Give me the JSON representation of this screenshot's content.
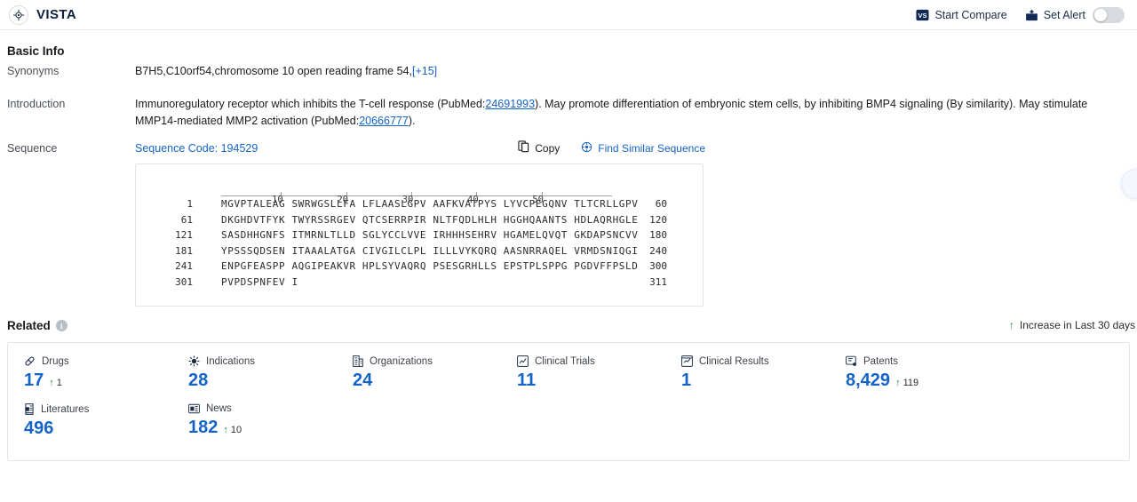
{
  "header": {
    "brand_icon": "target-crosshair-icon",
    "title": "VISTA",
    "start_compare": "Start Compare",
    "start_compare_icon": "vs-compare-icon",
    "set_alert": "Set Alert",
    "set_alert_icon": "alert-bell-icon",
    "alert_toggle_state": "off"
  },
  "basic_info": {
    "title": "Basic Info",
    "synonyms_label": "Synonyms",
    "synonyms_value": "B7H5,C10orf54,chromosome 10 open reading frame 54,",
    "synonyms_more": "[+15]",
    "introduction_label": "Introduction",
    "intro_part1": "Immunoregulatory receptor which inhibits the T-cell response (PubMed:",
    "intro_pmid1": "24691993",
    "intro_part2": "). May promote differentiation of embryonic stem cells, by inhibiting BMP4 signaling (By similarity). May stimulate MMP14-mediated MMP2 activation (PubMed:",
    "intro_pmid2": "20666777",
    "intro_part3": ")."
  },
  "sequence": {
    "label": "Sequence",
    "code_label": "Sequence Code: 194529",
    "copy_label": "Copy",
    "copy_icon": "copy-icon",
    "find_similar_label": "Find Similar Sequence",
    "find_similar_icon": "find-similar-icon",
    "ruler_ticks": [
      10,
      20,
      30,
      40,
      50
    ],
    "lines": [
      {
        "start": "1",
        "letters": "MGVPTALEAG SWRWGSLLFA LFLAASLGPV AAFKVATPYS LYVCPEGQNV TLTCRLLGPV",
        "end": "60"
      },
      {
        "start": "61",
        "letters": "DKGHDVTFYK TWYRSSRGEV QTCSERRPIR NLTFQDLHLH HGGHQAANTS HDLAQRHGLE",
        "end": "120"
      },
      {
        "start": "121",
        "letters": "SASDHHGNFS ITMRNLTLLD SGLYCCLVVE IRHHHSEHRV HGAMELQVQT GKDAPSNCVV",
        "end": "180"
      },
      {
        "start": "181",
        "letters": "YPSSSQDSEN ITAAALATGA CIVGILCLPL ILLLVYKQRQ AASNRRAQEL VRMDSNIQGI",
        "end": "240"
      },
      {
        "start": "241",
        "letters": "ENPGFEASPP AQGIPEAKVR HPLSYVAQRQ PSESGRHLLS EPSTPLSPPG PGDVFFPSLD",
        "end": "300"
      },
      {
        "start": "301",
        "letters": "PVPDSPNFEV I",
        "end": "311"
      }
    ]
  },
  "related": {
    "title": "Related",
    "info_icon": "info-icon",
    "increase_note": "Increase in Last 30 days",
    "increase_arrow_icon": "arrow-up-icon",
    "cards": [
      {
        "icon": "pill-drug-icon",
        "label": "Drugs",
        "value": "17",
        "delta": "1"
      },
      {
        "icon": "virus-indication-icon",
        "label": "Indications",
        "value": "28",
        "delta": ""
      },
      {
        "icon": "building-org-icon",
        "label": "Organizations",
        "value": "24",
        "delta": ""
      },
      {
        "icon": "clinical-trial-icon",
        "label": "Clinical Trials",
        "value": "11",
        "delta": ""
      },
      {
        "icon": "clinical-result-icon",
        "label": "Clinical Results",
        "value": "1",
        "delta": ""
      },
      {
        "icon": "patent-icon",
        "label": "Patents",
        "value": "8,429",
        "delta": "119"
      },
      {
        "icon": "literature-icon",
        "label": "Literatures",
        "value": "496",
        "delta": ""
      },
      {
        "icon": "news-icon",
        "label": "News",
        "value": "182",
        "delta": "10"
      }
    ]
  },
  "colors": {
    "link": "#1463c6",
    "brand_dark": "#10203c",
    "increase_green": "#1f8a3b",
    "border": "#e3e5e8"
  },
  "float_button": {
    "icon": "circle-assist-icon"
  }
}
